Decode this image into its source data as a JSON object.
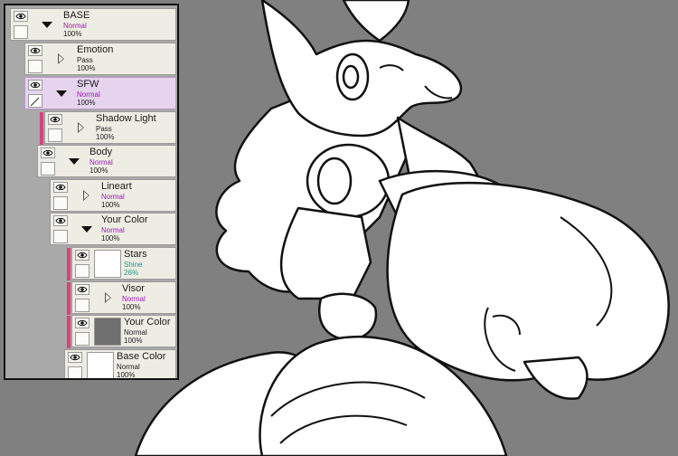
{
  "layers": [
    {
      "name": "BASE",
      "mode": "Normal",
      "opacity": "100%"
    },
    {
      "name": "Emotion",
      "mode": "Pass",
      "opacity": "100%"
    },
    {
      "name": "SFW",
      "mode": "Normal",
      "opacity": "100%"
    },
    {
      "name": "Shadow Light",
      "mode": "Pass",
      "opacity": "100%"
    },
    {
      "name": "Body",
      "mode": "Normal",
      "opacity": "100%"
    },
    {
      "name": "Lineart",
      "mode": "Normal",
      "opacity": "100%"
    },
    {
      "name": "Your Color",
      "mode": "Normal",
      "opacity": "100%"
    },
    {
      "name": "Stars",
      "mode": "Shine",
      "opacity": "26%"
    },
    {
      "name": "Visor",
      "mode": "Normal",
      "opacity": "100%"
    },
    {
      "name": "Your Color",
      "mode": "Normal",
      "opacity": "100%"
    },
    {
      "name": "Base Color",
      "mode": "Normal",
      "opacity": "100%"
    }
  ],
  "colors": {
    "canvas_bg": "#808080",
    "selected_layer": "#e6d3ee",
    "clip_strip": "#d5457c",
    "mode_purple": "#9a1cb4",
    "shine_teal": "#1a9a8a"
  }
}
